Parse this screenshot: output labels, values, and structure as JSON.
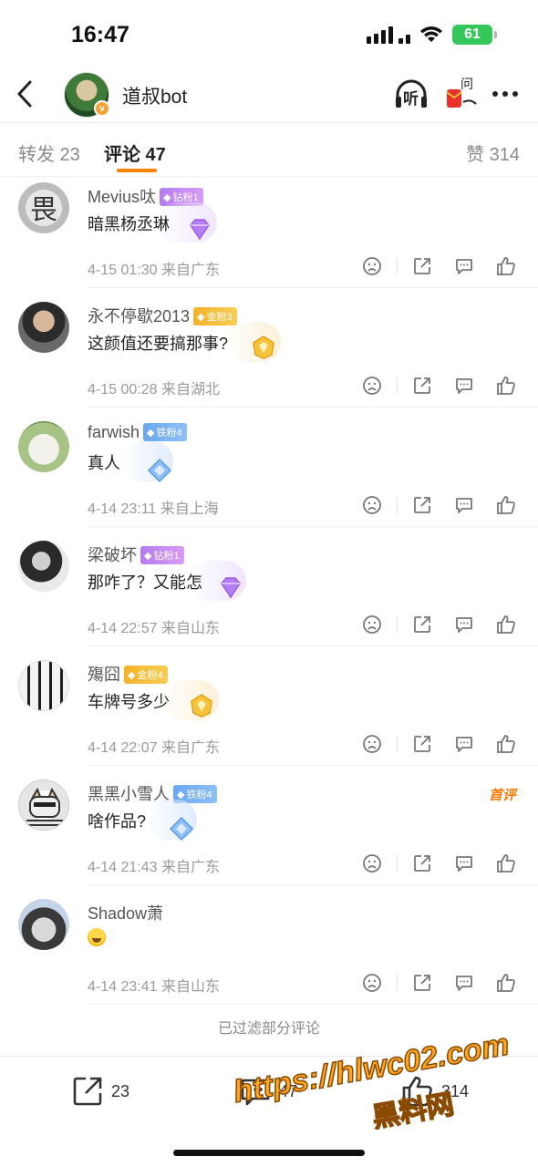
{
  "status_bar": {
    "time": "16:47",
    "battery": "61"
  },
  "header": {
    "title": "道叔bot",
    "verified_mark": "v",
    "listen_label": "听",
    "ask_label": "问",
    "colors": {
      "verified": "#f7a234"
    }
  },
  "tabs": {
    "repost": "转发 23",
    "comment": "评论 47",
    "like": "赞 314",
    "accent_color": "#ff8200"
  },
  "comments": [
    {
      "user": "Mevius呔",
      "badge": "钻粉1",
      "badge_type": "diamond",
      "text": "暗黑杨丞琳",
      "time": "4-15 01:30",
      "location": "来自广东",
      "first": ""
    },
    {
      "user": "永不停歇2013",
      "badge": "金粉3",
      "badge_type": "gold",
      "text": "这颜值还要搞那事?",
      "time": "4-15 00:28",
      "location": "来自湖北",
      "first": ""
    },
    {
      "user": "farwish",
      "badge": "铁粉4",
      "badge_type": "iron",
      "text": "真人",
      "time": "4-14 23:11",
      "location": "来自上海",
      "first": ""
    },
    {
      "user": "梁破坏",
      "badge": "钻粉1",
      "badge_type": "diamond",
      "text": "那咋了？又能怎",
      "time": "4-14 22:57",
      "location": "来自山东",
      "first": ""
    },
    {
      "user": "殤囧",
      "badge": "金粉4",
      "badge_type": "gold",
      "text": "车牌号多少",
      "time": "4-14 22:07",
      "location": "来自广东",
      "first": ""
    },
    {
      "user": "黑黑小雪人",
      "badge": "铁粉4",
      "badge_type": "iron",
      "text": "啥作品?",
      "time": "4-14 21:43",
      "location": "来自广东",
      "first": "首评"
    },
    {
      "user": "Shadow萧",
      "badge": "",
      "badge_type": "none",
      "text": "",
      "emoji": "laughing-emoji",
      "time": "4-14 23:41",
      "location": "来自山东",
      "first": ""
    }
  ],
  "filtered_note": "已过滤部分评论",
  "bottom_bar": {
    "repost_count": "23",
    "comment_count": "47",
    "like_count": "314"
  },
  "watermark": {
    "url": "https://hlwc02.com",
    "name": "黑料网"
  },
  "icons": [
    "back-icon",
    "headphone-icon",
    "red-envelope-icon",
    "more-icon",
    "dislike-icon",
    "share-icon",
    "reply-icon",
    "like-icon"
  ]
}
